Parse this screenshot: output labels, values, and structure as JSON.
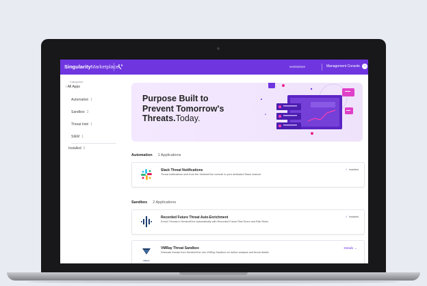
{
  "app": {
    "brand_bold": "Singularity",
    "brand_light": "Marketplace",
    "account": "sentinelone",
    "console_label": "Management Console",
    "accent_color": "#6f36e0"
  },
  "sidebar": {
    "categories_label": "Categories",
    "all_apps_label": "‹ All Apps",
    "items": [
      {
        "label": "Automation",
        "count": "1"
      },
      {
        "label": "Sandbox",
        "count": "2"
      },
      {
        "label": "Threat Intel",
        "count": "1"
      },
      {
        "label": "SIEM",
        "count": "1"
      }
    ],
    "installed": {
      "label": "Installed",
      "count": "2"
    }
  },
  "hero": {
    "line1": "Purpose Built to",
    "line2": "Prevent Tomorrow's",
    "line3_bold": "Threats.",
    "line3_light": "Today."
  },
  "sections": [
    {
      "name": "Automation",
      "count_label": "1 Applications",
      "apps": [
        {
          "title": "Slack Threat Notifications",
          "desc": "Threat notifications sent from the SentinelOne console to your dedicated Slack channel",
          "status": "Installed",
          "icon": "slack-icon"
        }
      ]
    },
    {
      "name": "Sandbox",
      "count_label": "2 Applications",
      "apps": [
        {
          "title": "Recorded Future Threat Auto-Enrichment",
          "desc": "Enrich Threats in SentinelOne automatically with Recorded Future Risk Score and Risk Rules",
          "status": "Installed",
          "icon": "recorded-future-icon"
        },
        {
          "title": "VMRay Threat Sandbox",
          "desc": "Detonate threats from SentinelOne into VMRay Sandbox for further analysis and threat details",
          "status": "Details →",
          "icon": "vmray-icon",
          "icon_text": "VMRAY"
        }
      ]
    }
  ]
}
